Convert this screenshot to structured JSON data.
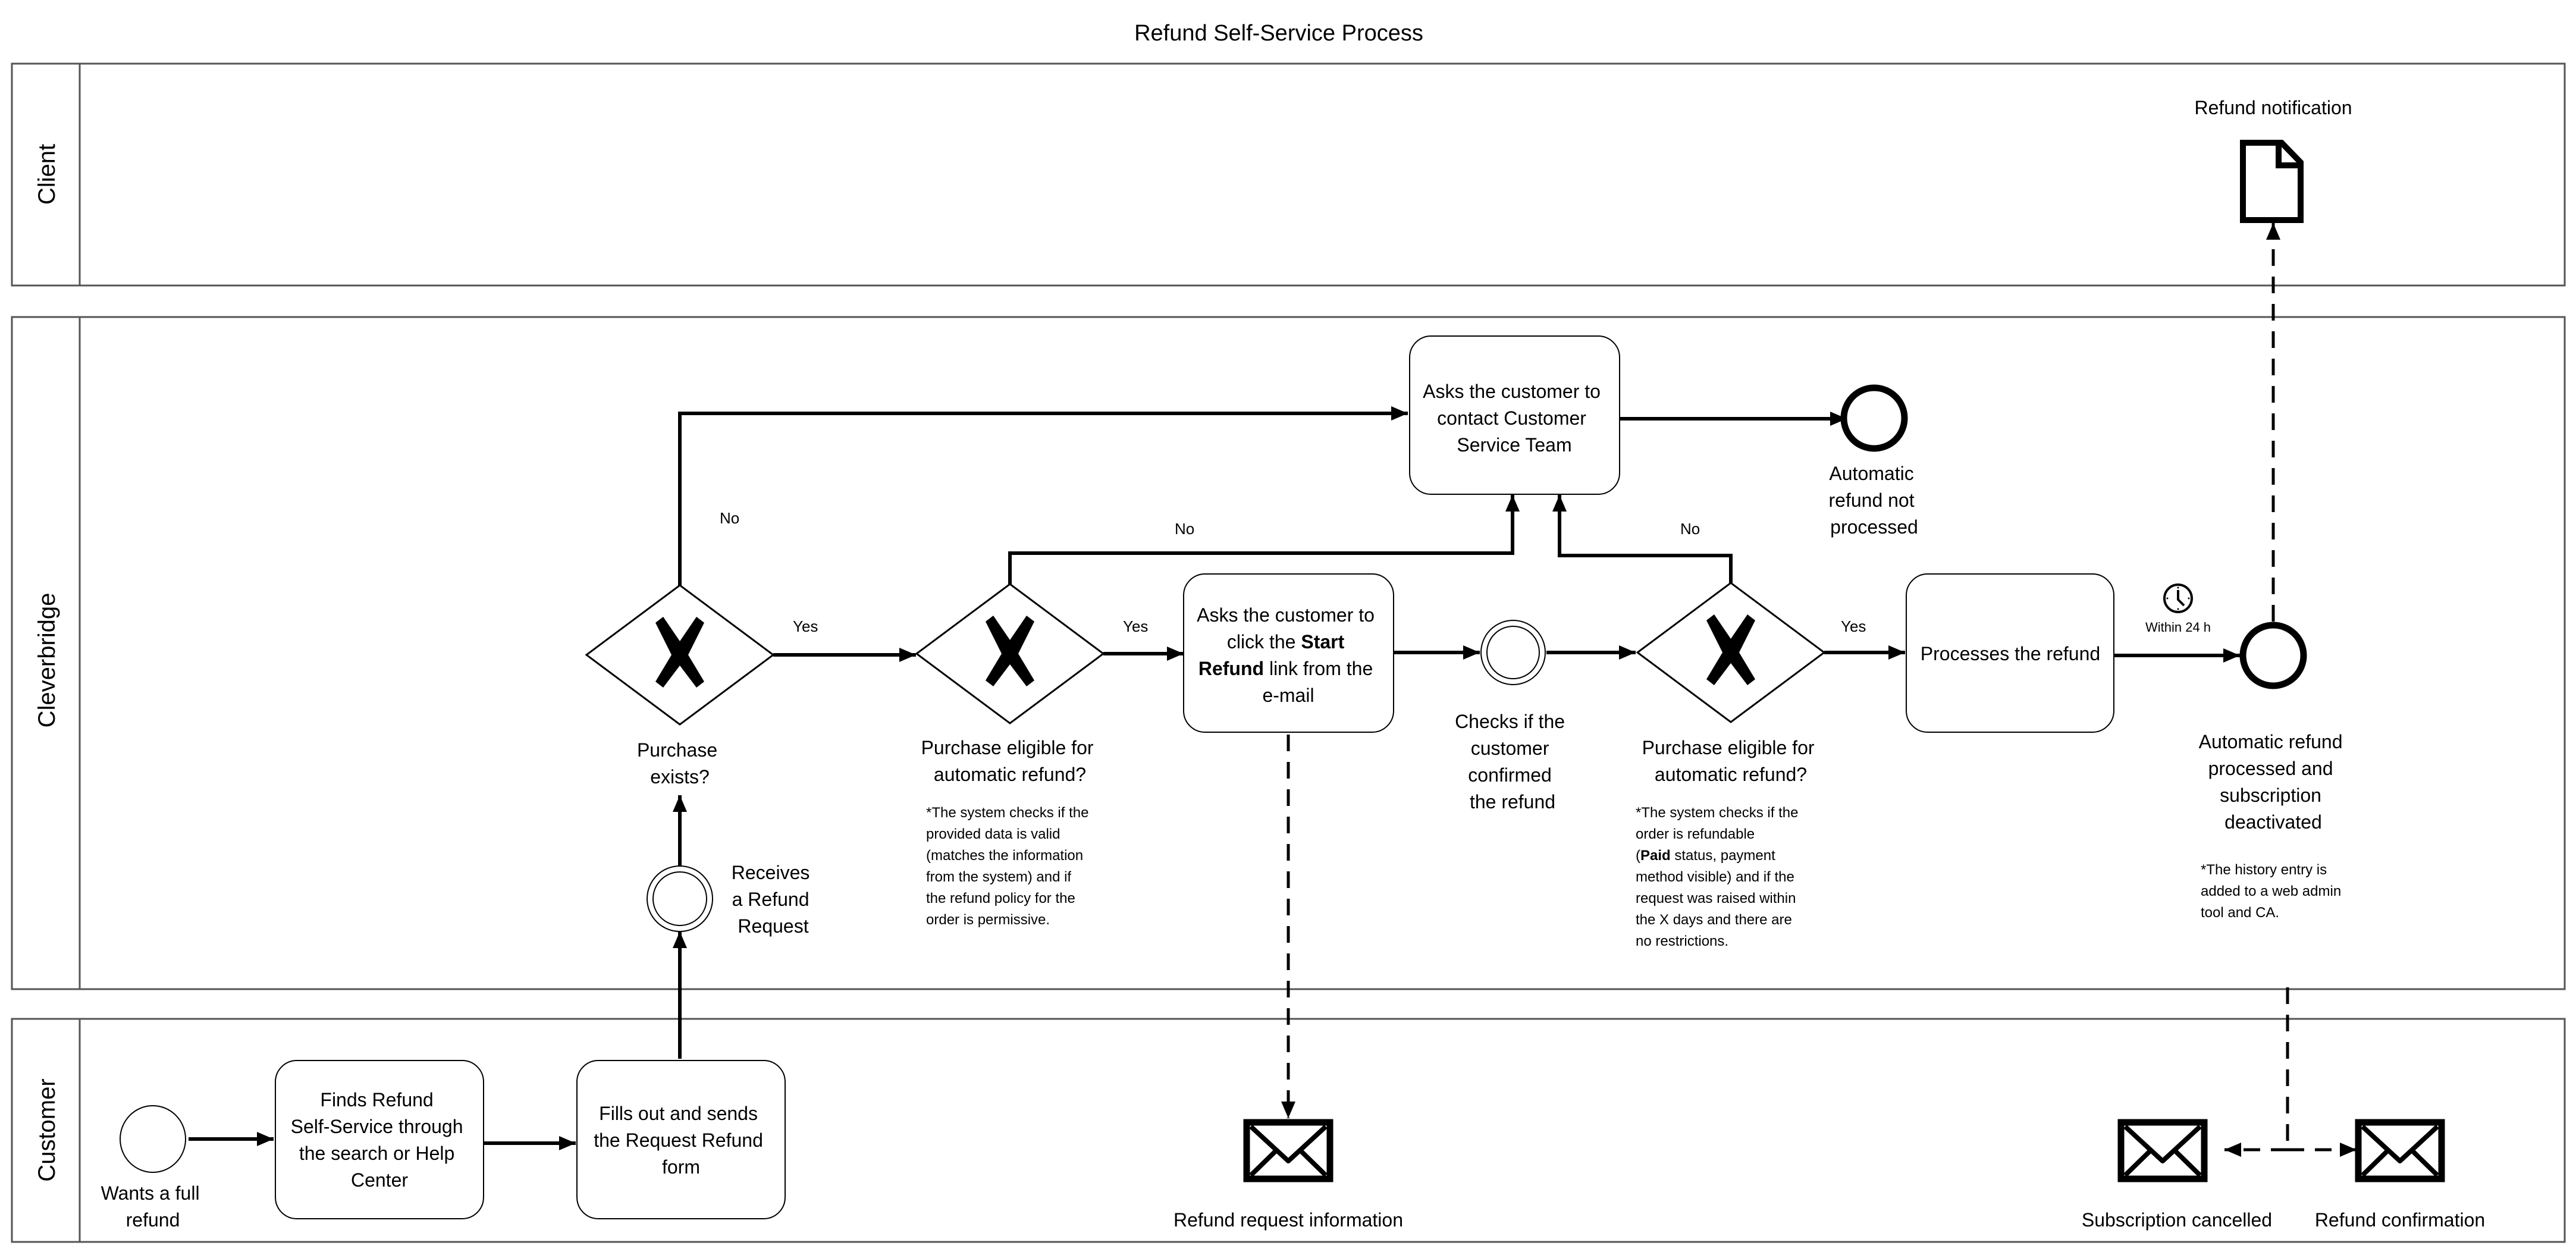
{
  "title": "Refund Self-Service Process",
  "lanes": [
    {
      "id": "client",
      "label": "Client"
    },
    {
      "id": "cleverbridge",
      "label": "Cleverbridge"
    },
    {
      "id": "customer",
      "label": "Customer"
    }
  ],
  "events": {
    "start": {
      "label": [
        "Wants a full",
        "refund"
      ]
    },
    "receives_request": {
      "label": [
        "Receives",
        "a Refund",
        "Request"
      ]
    },
    "checks_confirmed": {
      "label": [
        "Checks if the",
        "customer",
        "confirmed",
        "the refund"
      ]
    },
    "end_not_processed": {
      "label": [
        "Automatic",
        "refund not",
        "processed"
      ]
    },
    "end_processed": {
      "label": [
        "Automatic refund",
        "processed and",
        "subscription",
        "deactivated"
      ]
    }
  },
  "tasks": {
    "finds_refund": {
      "label": [
        "Finds Refund",
        "Self-Service through",
        "the search or Help",
        "Center"
      ]
    },
    "fills_out": {
      "label": [
        "Fills out and sends",
        "the Request Refund",
        "form"
      ]
    },
    "asks_start_refund": {
      "line1": "Asks the customer to",
      "line2_pre": "click the ",
      "line2_bold": "Start",
      "line3_bold": "Refund",
      "line3_post": " link from the",
      "line4": "e-mail"
    },
    "asks_contact": {
      "label": [
        "Asks the customer to",
        "contact Customer",
        "Service Team"
      ]
    },
    "processes_refund": {
      "label": [
        "Processes the refund"
      ]
    }
  },
  "gateways": {
    "purchase_exists": {
      "label": [
        "Purchase",
        "exists?"
      ]
    },
    "eligible_1": {
      "label": [
        "Purchase eligible for",
        "automatic refund?"
      ],
      "note": [
        "*The system checks if the",
        "provided data is valid",
        "(matches  the information",
        "from the system) and if",
        "the refund policy for the",
        "order is permissive."
      ]
    },
    "eligible_2": {
      "label": [
        "Purchase eligible for",
        "automatic refund?"
      ],
      "note_line1": "*The system checks if the",
      "note_line2": "order is refundable",
      "note_line3_pre": "(",
      "note_line3_bold": "Paid",
      "note_line3_post": " status, payment",
      "note_line4": "method visible) and if the",
      "note_line5": "request was raised within",
      "note_line6": "the X days and there are",
      "note_line7": "no restrictions."
    }
  },
  "flow_labels": {
    "yes_1": "Yes",
    "no_1": "No",
    "yes_2": "Yes",
    "no_2": "No",
    "yes_3": "Yes",
    "no_3": "No",
    "timer": "Within 24 h"
  },
  "artifacts": {
    "refund_notification": "Refund notification",
    "refund_request_information": "Refund request information",
    "subscription_cancelled": "Subscription cancelled",
    "refund_confirmation": "Refund confirmation"
  },
  "notes": {
    "history": [
      "*The history entry is",
      "added to a web admin",
      "tool and CA."
    ]
  },
  "icons": {
    "gateway": "exclusive-gateway-x-icon",
    "timer": "clock-icon",
    "message": "envelope-icon",
    "document": "document-icon"
  }
}
